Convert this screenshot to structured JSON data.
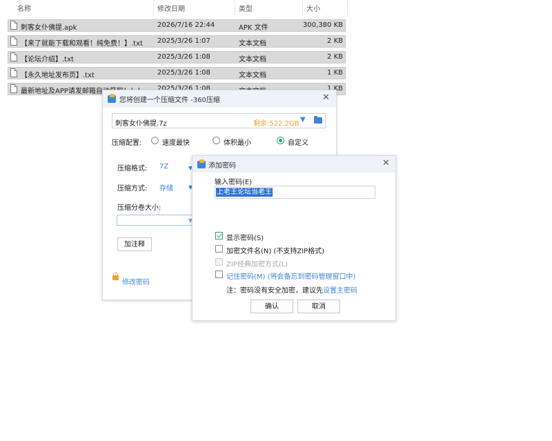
{
  "explorer": {
    "columns": {
      "name": "名称",
      "date": "修改日期",
      "type": "类型",
      "size": "大小"
    },
    "files": [
      {
        "name": "刺客女仆佛提.apk",
        "date": "2026/7/16 22:44",
        "type": "APK 文件",
        "size": "300,380 KB"
      },
      {
        "name": "【来了就能下载和观看！纯免费！】.txt",
        "date": "2025/3/26 1:07",
        "type": "文本文档",
        "size": "2 KB"
      },
      {
        "name": "【论坛介绍】.txt",
        "date": "2025/3/26 1:08",
        "type": "文本文档",
        "size": "2 KB"
      },
      {
        "name": "【永久地址发布页】.txt",
        "date": "2025/3/26 1:08",
        "type": "文本文档",
        "size": "1 KB"
      },
      {
        "name": "最新地址及APP请发邮箱自动获取！！！",
        "date": "2025/3/26 1:08",
        "type": "文本文档",
        "size": "1 KB"
      }
    ]
  },
  "compress_dialog": {
    "title": "您将创建一个压缩文件 -360压缩",
    "filename": "刺客女仆佛提.7z",
    "free_space": "剩余:522.2GB",
    "config_label": "压缩配置:",
    "options": [
      "速度最快",
      "体积最小",
      "自定义"
    ],
    "format_label": "压缩格式:",
    "format_value": "7Z",
    "method_label": "压缩方式:",
    "method_value": "存储",
    "split_label": "压缩分卷大小:",
    "add_comment": "加注释",
    "change_password": "修改密码"
  },
  "password_dialog": {
    "title": "添加密码",
    "input_label": "输入密码(E)",
    "password": "上老王论坛当老王",
    "show_password": "显示密码(S)",
    "encrypt_names": "加密文件名(N) (不支持ZIP格式)",
    "zip_classic": "ZIP经典加密方式(L)",
    "remember": "记住密码(M) (将会备忘到密码管理窗口中)",
    "note_prefix": "注：密码没有安全加密，建议先",
    "note_link": "设置主密码",
    "ok": "确认",
    "cancel": "取消"
  }
}
